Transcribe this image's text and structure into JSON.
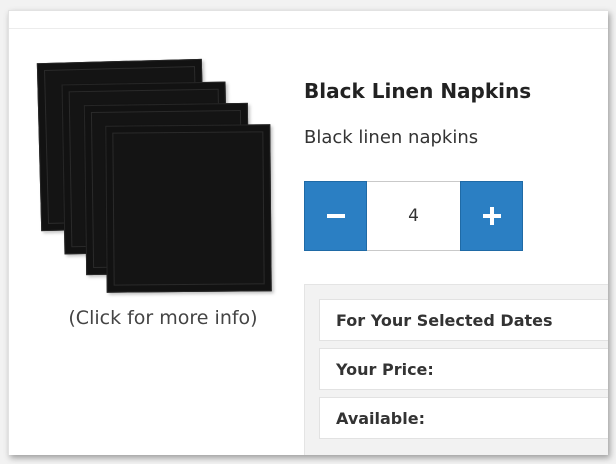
{
  "product": {
    "title": "Black Linen Napkins",
    "description": "Black linen napkins",
    "image_caption": "(Click for more info)",
    "image_color": "#141414"
  },
  "quantity": {
    "value": "4",
    "decrement_icon": "minus-icon",
    "increment_icon": "plus-icon",
    "button_color": "#2b7fc3"
  },
  "info": {
    "rows": [
      {
        "label": "For Your Selected Dates"
      },
      {
        "label": "Your Price:"
      },
      {
        "label": "Available:"
      }
    ]
  }
}
